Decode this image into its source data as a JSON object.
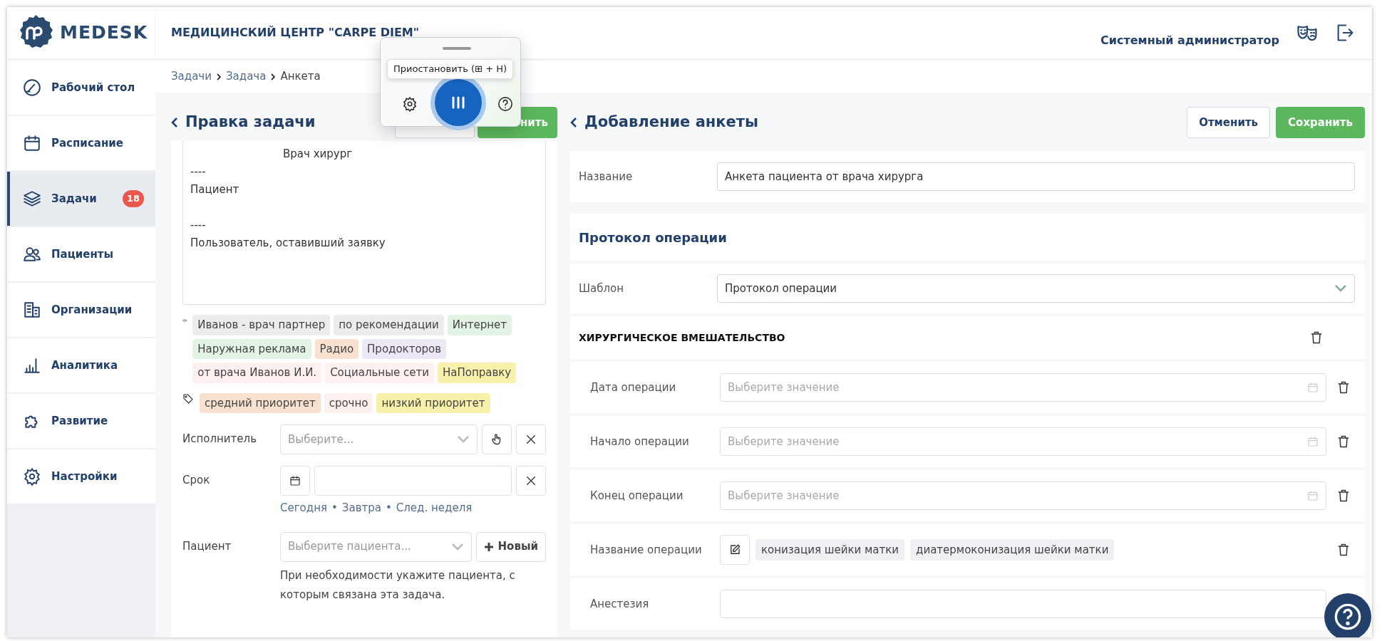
{
  "header": {
    "logo": "MEDESK",
    "clinic": "МЕДИЦИНСКИЙ ЦЕНТР \"CARPE DIEM\"",
    "user_role": "Системный администратор"
  },
  "sidebar": {
    "items": [
      {
        "label": "Рабочий стол",
        "selected": false
      },
      {
        "label": "Расписание",
        "selected": false
      },
      {
        "label": "Задачи",
        "selected": true,
        "badge": "18"
      },
      {
        "label": "Пациенты",
        "selected": false
      },
      {
        "label": "Организации",
        "selected": false
      },
      {
        "label": "Аналитика",
        "selected": false
      },
      {
        "label": "Развитие",
        "selected": false
      },
      {
        "label": "Настройки",
        "selected": false
      }
    ]
  },
  "breadcrumbs": [
    "Задачи",
    "Задача",
    "Анкета"
  ],
  "task_panel": {
    "title": "Правка задачи",
    "save_button": "нить",
    "description_lines": [
      "Врач хирург",
      "----",
      "Пациент",
      "----",
      "Пользователь, оставивший заявку"
    ],
    "sources": [
      {
        "label": "Иванов - врач партнер",
        "color": "#ececec"
      },
      {
        "label": "по рекомендации",
        "color": "#ececec"
      },
      {
        "label": "Интернет",
        "color": "#e3f3e4"
      },
      {
        "label": "Наружная реклама",
        "color": "#e3f3e4"
      },
      {
        "label": "Радио",
        "color": "#f8e2cf"
      },
      {
        "label": "Продокторов",
        "color": "#eee7f6"
      },
      {
        "label": "от врача Иванов И.И.",
        "color": "#fdf1ef"
      },
      {
        "label": "Социальные сети",
        "color": "#fdf1ef"
      },
      {
        "label": "НаПоправку",
        "color": "#f7f1ac"
      }
    ],
    "tags": [
      {
        "label": "средний приоритет",
        "color": "#f8e2cf"
      },
      {
        "label": "срочно",
        "color": "#fdf1ef"
      },
      {
        "label": "низкий приоритет",
        "color": "#f7f1ac"
      }
    ],
    "executor": {
      "label": "Исполнитель",
      "placeholder": "Выберите..."
    },
    "deadline": {
      "label": "Срок",
      "separator": "•",
      "quick_links": [
        "Сегодня",
        "Завтра",
        "След. неделя"
      ]
    },
    "patient": {
      "label": "Пациент",
      "placeholder": "Выберите пациента...",
      "new_button": "Новый",
      "help": "При необходимости укажите пациента, с которым связана эта задача."
    }
  },
  "form_panel": {
    "title": "Добавление анкеты",
    "cancel_button": "Отменить",
    "save_button": "Сохранить",
    "name": {
      "label": "Название",
      "value": "Анкета пациента от врача хирурга"
    },
    "section_title": "Протокол операции",
    "template": {
      "label": "Шаблон",
      "value": "Протокол операции"
    },
    "group": {
      "title": "ХИРУРГИЧЕСКОЕ ВМЕШАТЕЛЬСТВО",
      "fields": [
        {
          "kind": "date",
          "label": "Дата операции",
          "placeholder": "Выберите значение"
        },
        {
          "kind": "date",
          "label": "Начало операции",
          "placeholder": "Выберите значение"
        },
        {
          "kind": "date",
          "label": "Конец операции",
          "placeholder": "Выберите значение"
        },
        {
          "kind": "chips",
          "label": "Название операции",
          "chips": [
            "конизация шейки матки",
            "диатермоконизация шейки матки"
          ]
        },
        {
          "kind": "text",
          "label": "Анестезия"
        }
      ]
    }
  },
  "voice_toolbar": {
    "tooltip": "Приостановить (⊞ + H)"
  }
}
